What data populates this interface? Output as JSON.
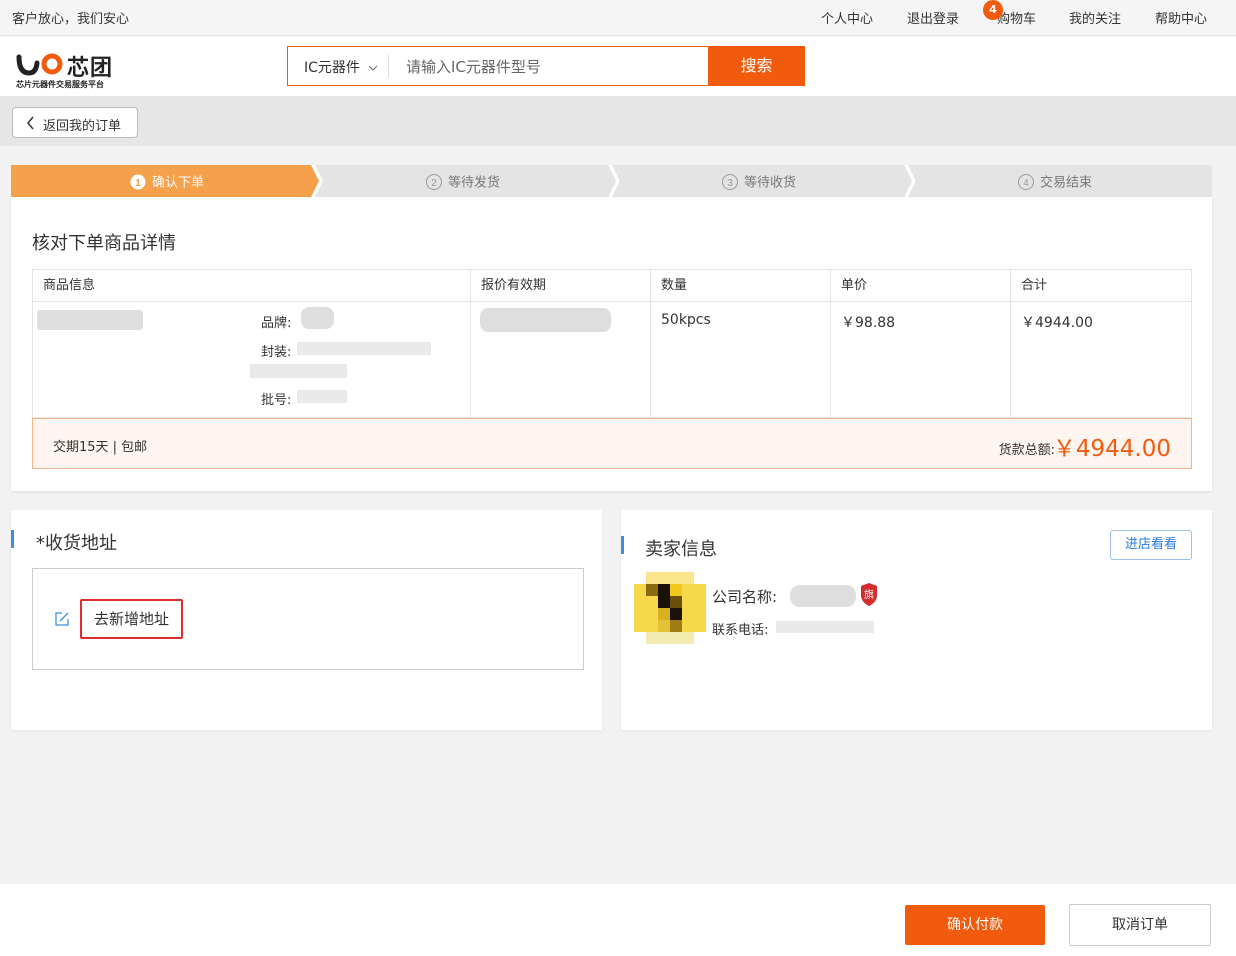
{
  "topbar": {
    "slogan": "客户放心，我们安心",
    "links": {
      "profile": "个人中心",
      "logout": "退出登录",
      "cart": "购物车",
      "follow": "我的关注",
      "help": "帮助中心"
    },
    "cart_count": "4"
  },
  "header": {
    "logo_text": "芯团",
    "logo_sub": "芯片元器件交易服务平台",
    "search_category": "IC元器件",
    "search_placeholder": "请输入IC元器件型号",
    "search_button": "搜索"
  },
  "back_button": "返回我的订单",
  "steps": [
    {
      "num": "1",
      "label": "确认下单",
      "active": true
    },
    {
      "num": "2",
      "label": "等待发货",
      "active": false
    },
    {
      "num": "3",
      "label": "等待收货",
      "active": false
    },
    {
      "num": "4",
      "label": "交易结束",
      "active": false
    }
  ],
  "order": {
    "title": "核对下单商品详情",
    "columns": [
      "商品信息",
      "报价有效期",
      "数量",
      "单价",
      "合计"
    ],
    "item": {
      "brand_label": "品牌:",
      "package_label": "封装:",
      "batch_label": "批号:",
      "quantity": "50kpcs",
      "unit_price": "￥98.88",
      "subtotal": "￥4944.00"
    },
    "delivery_note": "交期15天 | 包邮",
    "total_label": "货款总额:",
    "total_value": "￥4944.00"
  },
  "address": {
    "title": "*收货地址",
    "add_button": "去新增地址"
  },
  "seller": {
    "title": "卖家信息",
    "visit_button": "进店看看",
    "company_label": "公司名称:",
    "flag_badge": "旗",
    "phone_label": "联系电话:"
  },
  "footer": {
    "confirm_pay": "确认付款",
    "cancel_order": "取消订单"
  },
  "colors": {
    "accent": "#f25a0d",
    "step_active": "#f5a04a",
    "link_blue": "#2a79e0"
  }
}
